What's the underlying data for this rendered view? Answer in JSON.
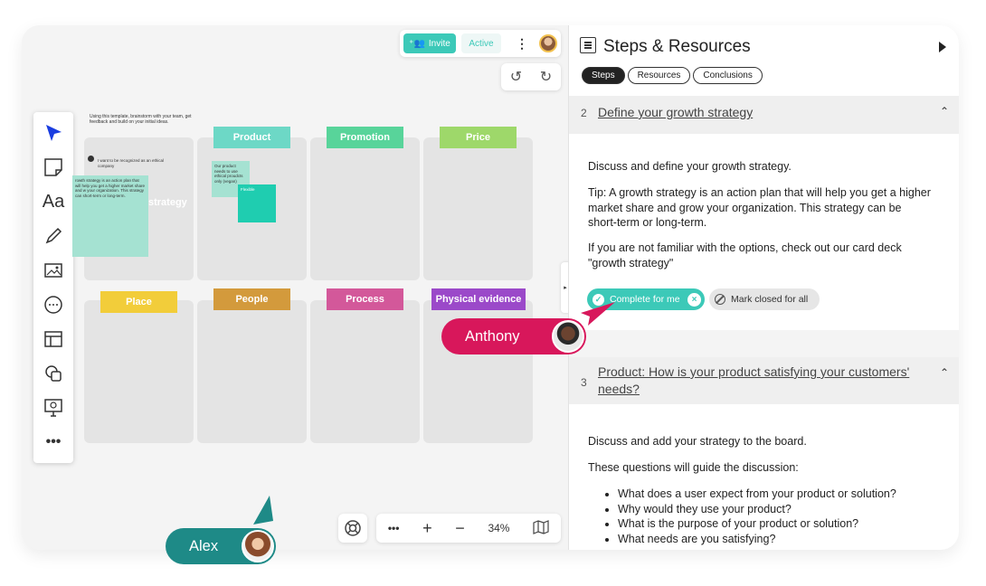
{
  "topbar": {
    "invite_label": "Invite",
    "active_label": "Active"
  },
  "canvas": {
    "intro_text": "Using this template, brainstorm with your team, get feedback and build on your initial ideas.",
    "labels": [
      {
        "text": "Product",
        "color": "#6dd8c6"
      },
      {
        "text": "Promotion",
        "color": "#58d49a"
      },
      {
        "text": "Price",
        "color": "#9ed86a"
      },
      {
        "text": "Place",
        "color": "#f2cd3a"
      },
      {
        "text": "People",
        "color": "#d39a3c"
      },
      {
        "text": "Process",
        "color": "#d3589a"
      },
      {
        "text": "Physical evidence",
        "color": "#9b49c9"
      }
    ],
    "note_recognized": "I want to be recognized as an ethical company",
    "note_strategy": "rowth strategy is an action plan that will help you get a higher market share and w your organization. This strategy can short-term or long-term.",
    "note_strategy_overlay": "strategy",
    "note_product": "Our product needs to use ethical proudcts only (vegan)",
    "note_flexible": "Flexible",
    "zoom": "34%"
  },
  "panel": {
    "title": "Steps & Resources",
    "tabs": [
      "Steps",
      "Resources",
      "Conclusions"
    ],
    "step2": {
      "num": "2",
      "title": "Define your growth strategy",
      "p1": "Discuss and define your growth strategy.",
      "p2": "Tip: A growth strategy is an action plan that will help you get a higher market share and grow your organization. This strategy can be short-term or long-term.",
      "p3": "If you are not familiar with the options, check out our card deck \"growth strategy\"",
      "complete_label": "Complete for me",
      "close_label": "Mark closed for all"
    },
    "step3": {
      "num": "3",
      "title": "Product: How is your product satisfying your customers' needs?",
      "p1": "Discuss and add your strategy to the board.",
      "p2": "These questions will guide the discussion:",
      "bullets": [
        "What does a user expect from your product or solution?",
        "Why would they use your product?",
        "What is the purpose of your product or solution?",
        "What needs are you satisfying?"
      ]
    }
  },
  "cursors": {
    "anthony": "Anthony",
    "alex": "Alex"
  }
}
